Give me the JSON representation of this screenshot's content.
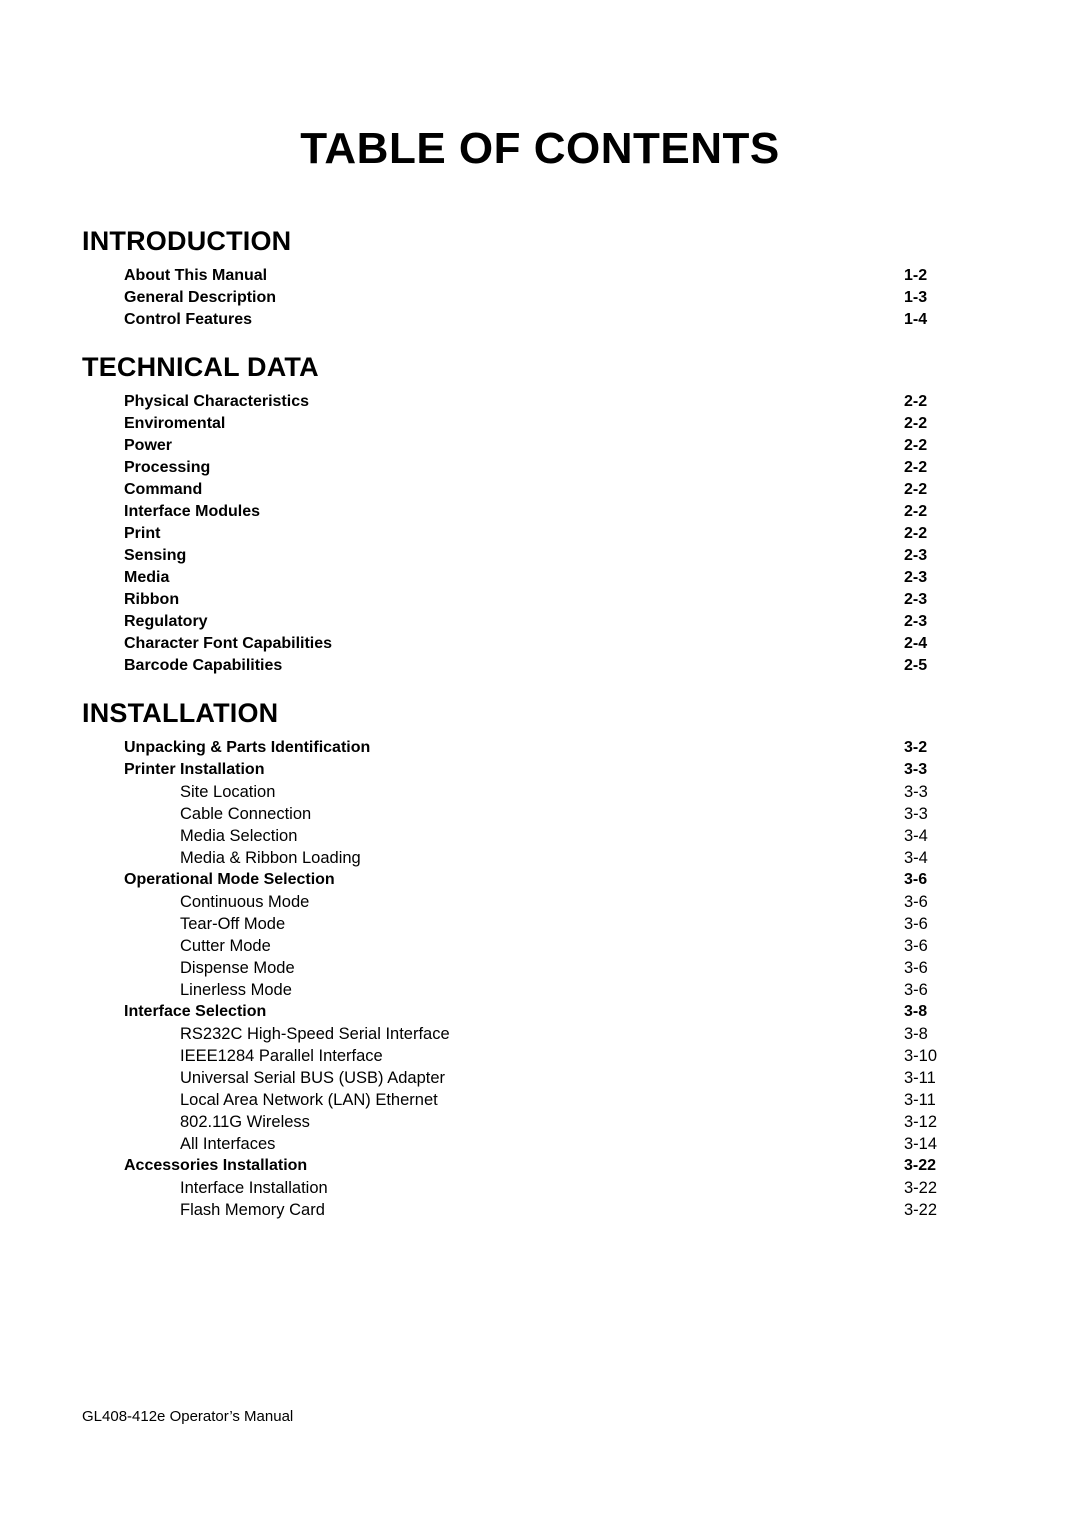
{
  "document": {
    "title": "TABLE OF CONTENTS",
    "footer": "GL408-412e Operator’s Manual"
  },
  "sections": [
    {
      "heading": "INTRODUCTION",
      "entries": [
        {
          "level": 2,
          "label": "About This Manual",
          "page": "1-2"
        },
        {
          "level": 2,
          "label": "General Description",
          "page": "1-3"
        },
        {
          "level": 2,
          "label": "Control Features",
          "page": "1-4"
        }
      ]
    },
    {
      "heading": "TECHNICAL DATA",
      "entries": [
        {
          "level": 2,
          "label": "Physical Characteristics",
          "page": "2-2"
        },
        {
          "level": 2,
          "label": "Enviromental",
          "page": "2-2"
        },
        {
          "level": 2,
          "label": "Power",
          "page": "2-2"
        },
        {
          "level": 2,
          "label": "Processing",
          "page": "2-2"
        },
        {
          "level": 2,
          "label": "Command",
          "page": "2-2"
        },
        {
          "level": 2,
          "label": "Interface Modules",
          "page": "2-2"
        },
        {
          "level": 2,
          "label": "Print",
          "page": "2-2"
        },
        {
          "level": 2,
          "label": "Sensing",
          "page": "2-3"
        },
        {
          "level": 2,
          "label": "Media",
          "page": "2-3"
        },
        {
          "level": 2,
          "label": "Ribbon",
          "page": "2-3"
        },
        {
          "level": 2,
          "label": "Regulatory",
          "page": "2-3"
        },
        {
          "level": 2,
          "label": "Character Font Capabilities",
          "page": "2-4"
        },
        {
          "level": 2,
          "label": "Barcode Capabilities",
          "page": "2-5"
        }
      ]
    },
    {
      "heading": "INSTALLATION",
      "entries": [
        {
          "level": 2,
          "label": "Unpacking & Parts Identification",
          "page": "3-2"
        },
        {
          "level": 2,
          "label": "Printer Installation",
          "page": "3-3"
        },
        {
          "level": 3,
          "label": "Site Location",
          "page": "3-3"
        },
        {
          "level": 3,
          "label": "Cable Connection",
          "page": "3-3"
        },
        {
          "level": 3,
          "label": "Media Selection",
          "page": "3-4"
        },
        {
          "level": 3,
          "label": "Media & Ribbon Loading",
          "page": "3-4"
        },
        {
          "level": 2,
          "label": "Operational Mode Selection",
          "page": "3-6"
        },
        {
          "level": 3,
          "label": "Continuous Mode",
          "page": "3-6"
        },
        {
          "level": 3,
          "label": "Tear-Off Mode",
          "page": "3-6"
        },
        {
          "level": 3,
          "label": "Cutter Mode",
          "page": "3-6"
        },
        {
          "level": 3,
          "label": "Dispense Mode",
          "page": "3-6"
        },
        {
          "level": 3,
          "label": "Linerless Mode",
          "page": "3-6"
        },
        {
          "level": 2,
          "label": "Interface Selection",
          "page": "3-8"
        },
        {
          "level": 3,
          "label": "RS232C High-Speed Serial Interface",
          "page": "3-8"
        },
        {
          "level": 3,
          "label": "IEEE1284 Parallel Interface",
          "page": "3-10"
        },
        {
          "level": 3,
          "label": "Universal Serial BUS (USB) Adapter",
          "page": "3-11"
        },
        {
          "level": 3,
          "label": "Local Area Network (LAN) Ethernet",
          "page": "3-11"
        },
        {
          "level": 3,
          "label": "802.11G Wireless",
          "page": "3-12"
        },
        {
          "level": 3,
          "label": "All Interfaces",
          "page": "3-14"
        },
        {
          "level": 2,
          "label": "Accessories Installation",
          "page": "3-22"
        },
        {
          "level": 3,
          "label": "Interface Installation",
          "page": "3-22"
        },
        {
          "level": 3,
          "label": "Flash Memory Card",
          "page": "3-22"
        }
      ]
    }
  ]
}
